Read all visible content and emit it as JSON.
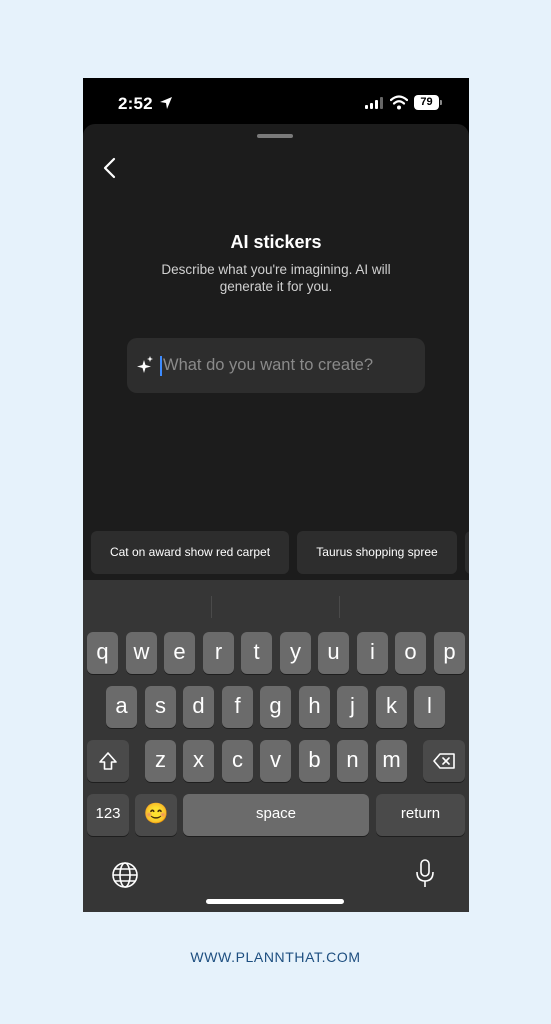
{
  "status_bar": {
    "time": "2:52",
    "battery": "79"
  },
  "sheet": {
    "title": "AI stickers",
    "subtitle": "Describe what you're imagining. AI will generate it for you.",
    "prompt_placeholder": "What do you want to create?",
    "suggestions": [
      "Cat on award show red carpet",
      "Taurus shopping spree"
    ]
  },
  "keyboard": {
    "row1": [
      "q",
      "w",
      "e",
      "r",
      "t",
      "y",
      "u",
      "i",
      "o",
      "p"
    ],
    "row2": [
      "a",
      "s",
      "d",
      "f",
      "g",
      "h",
      "j",
      "k",
      "l"
    ],
    "row3": [
      "z",
      "x",
      "c",
      "v",
      "b",
      "n",
      "m"
    ],
    "numbers_label": "123",
    "emoji_label": "😊",
    "space_label": "space",
    "return_label": "return"
  },
  "footer": {
    "website": "WWW.PLANNTHAT.COM"
  },
  "colors": {
    "sheet_bg": "#1c1c1c",
    "keyboard_bg": "#363636",
    "key_bg": "#6b6b6b",
    "caret": "#3d8bff",
    "page_bg": "#e6f2fb"
  }
}
